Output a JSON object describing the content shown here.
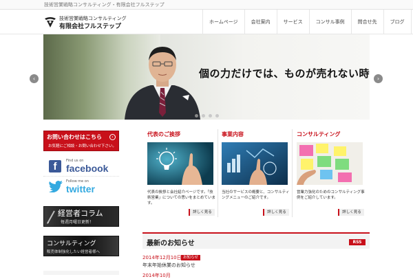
{
  "site": {
    "tagline": "技術営業戦略コンサルティング・有限会社フルステップ",
    "logo_line1": "技術営業戦略コンサルティング",
    "logo_line2": "有限会社フルステップ"
  },
  "nav": {
    "items": [
      {
        "label": "ホームページ"
      },
      {
        "label": "会社案内"
      },
      {
        "label": "サービス"
      },
      {
        "label": "コンサル事例"
      },
      {
        "label": "問合せ先"
      },
      {
        "label": "ブログ"
      }
    ]
  },
  "slider": {
    "catch": "個の力だけでは、ものが売れない時代",
    "prev": "‹",
    "next": "›",
    "dots": 4,
    "active_dot": 1
  },
  "sidebar": {
    "contact_title": "お問い合わせはこちら",
    "contact_arrow": "›",
    "contact_sub": "お気軽にご相談・お問い合わせ下さい。",
    "fb_findus": "Find us on",
    "fb_label": "facebook",
    "tw_follow": "Follow me on",
    "tw_label": "twitter",
    "column_title": "経営者コラム",
    "column_sub": "毎週月曜日更新！",
    "consult_title": "コンサルティング",
    "consult_sub": "販売体制強化したい経営者様へ"
  },
  "cards": [
    {
      "title": "代表のご挨拶",
      "text": "代表の挨拶と会社紹介ページです。「技術営業」についての思いをまとめています。",
      "more": "詳しく見る"
    },
    {
      "title": "事業内容",
      "text": "当社のサービスの概要と、コンサルティングメニューのご紹介です。",
      "more": "詳しく見る"
    },
    {
      "title": "コンサルティング",
      "text": "営業力強化のためのコンサルティング事例をご紹介しています。",
      "more": "詳しく見る"
    }
  ],
  "news": {
    "title": "最新のお知らせ",
    "rss": "RSS",
    "items": [
      {
        "date": "2014年12月10日",
        "category": "お知らせ",
        "text": "年末年始休業のお知らせ"
      },
      {
        "date": "2014年10月",
        "category": "",
        "text": ""
      }
    ]
  },
  "colors": {
    "accent": "#c8101a",
    "facebook": "#3b5998",
    "twitter": "#33a9e0"
  }
}
